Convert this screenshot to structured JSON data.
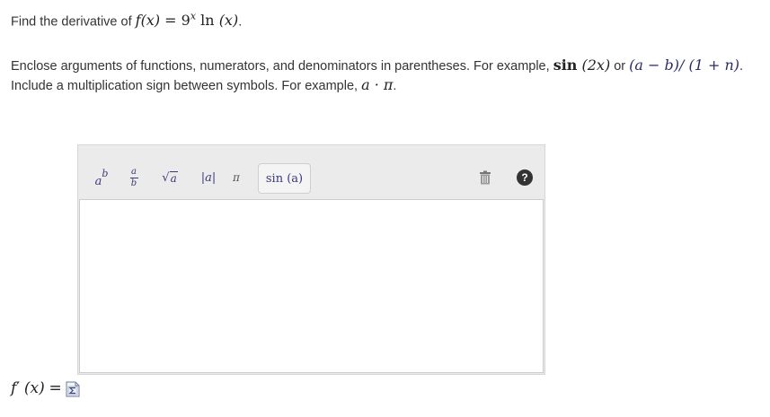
{
  "question": {
    "prefix": "Find the derivative of",
    "func_f": "f",
    "func_args": "(x)",
    "eq": "=",
    "base": "9",
    "exp": "x",
    "ln": "ln",
    "ln_args": "(x)",
    "period": "."
  },
  "instructions": {
    "line1_text": "Enclose arguments of functions, numerators, and denominators in parentheses. For example,",
    "ex1_fn": "sin",
    "ex1_arg": "(2x)",
    "or": "or",
    "ex2": "(a − b)/ (1 + n)",
    "line1_end": ".",
    "line2_text": "Include a multiplication sign between symbols. For example,",
    "ex3": "a · π",
    "line2_end": "."
  },
  "toolbar": {
    "power_base": "a",
    "power_exp": "b",
    "frac_num": "a",
    "frac_den": "b",
    "sqrt_sym": "√",
    "sqrt_arg": "a",
    "abs_label": "|a|",
    "pi_label": "π",
    "sin_label": "sin (a)",
    "help_label": "?"
  },
  "answer": {
    "label_f": "f",
    "label_prime": "′",
    "label_args": "(x)",
    "label_eq": "="
  },
  "colors": {
    "toolbar_bg": "#ebebeb",
    "help_bg": "#333333",
    "math_color": "#2a2a6a"
  }
}
